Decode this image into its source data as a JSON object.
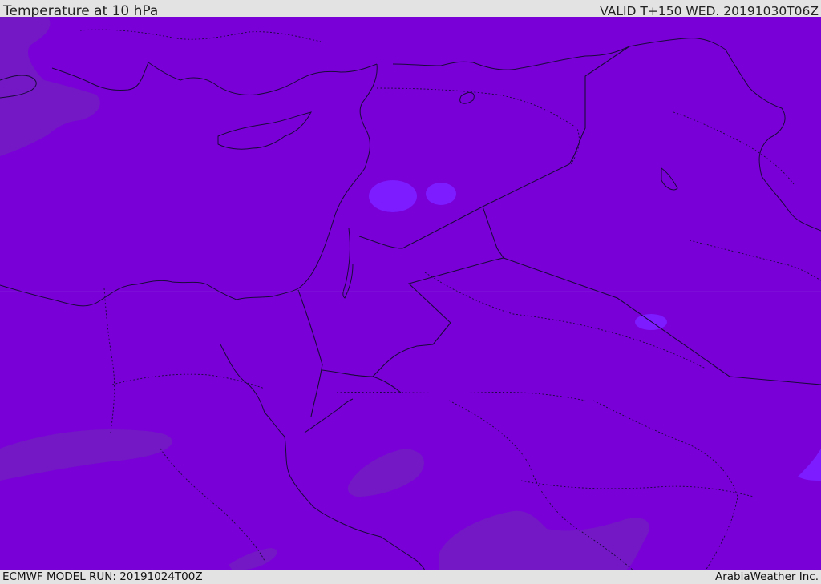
{
  "header": {
    "title": "Temperature at 10 hPa",
    "valid": "VALID T+150 WED. 20191030T06Z"
  },
  "footer": {
    "model_run": "ECMWF MODEL RUN: 20191024T00Z",
    "credit": "ArabiaWeather Inc."
  },
  "map": {
    "field": "Temperature",
    "level": "10 hPa",
    "colors": {
      "base_field": "#7a00d8",
      "warmer_field": "#7318c4",
      "cooler_field": "#7c1cff",
      "coastline": "#1a0a3a",
      "border": "#1a0a3a"
    }
  }
}
